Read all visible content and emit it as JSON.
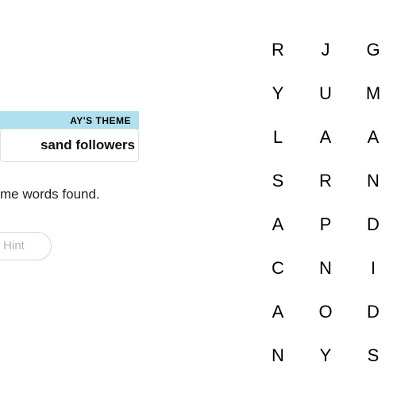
{
  "theme": {
    "header_label": "AY'S THEME",
    "title": "sand followers"
  },
  "status": {
    "text": "me words found."
  },
  "hint": {
    "label": "Hint"
  },
  "grid": {
    "rows": [
      [
        "R",
        "J",
        "G"
      ],
      [
        "Y",
        "U",
        "M"
      ],
      [
        "L",
        "A",
        "A"
      ],
      [
        "S",
        "R",
        "N"
      ],
      [
        "A",
        "P",
        "D"
      ],
      [
        "C",
        "N",
        "I"
      ],
      [
        "A",
        "O",
        "D"
      ],
      [
        "N",
        "Y",
        "S"
      ]
    ]
  }
}
